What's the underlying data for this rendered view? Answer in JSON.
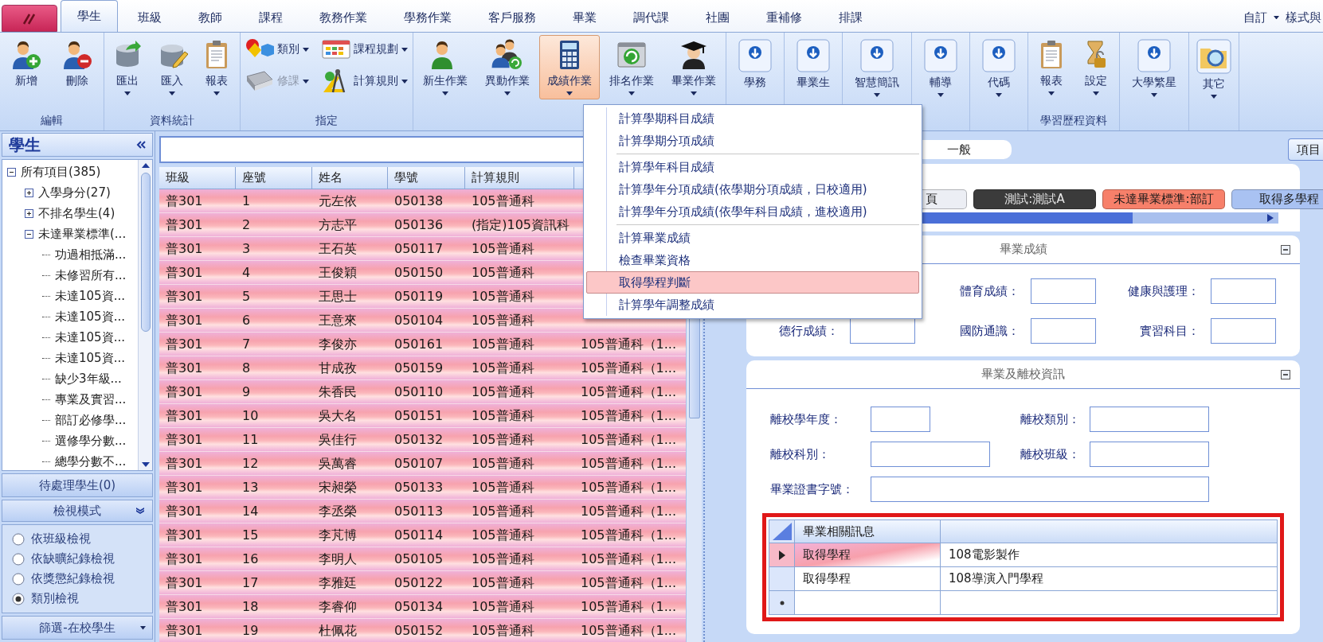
{
  "tabs": [
    {
      "label": "學生",
      "selected": true
    },
    {
      "label": "班級",
      "selected": false
    },
    {
      "label": "教師",
      "selected": false
    },
    {
      "label": "課程",
      "selected": false
    },
    {
      "label": "教務作業",
      "selected": false
    },
    {
      "label": "學務作業",
      "selected": false
    },
    {
      "label": "客戶服務",
      "selected": false
    },
    {
      "label": "畢業",
      "selected": false
    },
    {
      "label": "調代課",
      "selected": false
    },
    {
      "label": "社團",
      "selected": false
    },
    {
      "label": "重補修",
      "selected": false
    },
    {
      "label": "排課",
      "selected": false
    }
  ],
  "quick": {
    "customize": "自訂",
    "style": "樣式與"
  },
  "ribbon": [
    {
      "label": "編輯",
      "items": [
        {
          "kind": "large",
          "label": "新增",
          "dropdown": false,
          "pressed": false
        },
        {
          "kind": "large",
          "label": "刪除",
          "dropdown": false,
          "pressed": false
        }
      ]
    },
    {
      "label": "資料統計",
      "items": [
        {
          "kind": "large",
          "label": "匯出",
          "dropdown": true,
          "pressed": false
        },
        {
          "kind": "large",
          "label": "匯入",
          "dropdown": true,
          "pressed": false
        },
        {
          "kind": "large",
          "label": "報表",
          "dropdown": true,
          "pressed": false
        }
      ]
    },
    {
      "label": "指定",
      "items": [
        {
          "kind": "small",
          "label": "類別",
          "dropdown": true,
          "disabled": false
        },
        {
          "kind": "small",
          "label": "課程規劃",
          "dropdown": true,
          "disabled": false
        },
        {
          "kind": "small",
          "label": "修課",
          "dropdown": true,
          "disabled": true
        },
        {
          "kind": "small",
          "label": "計算規則",
          "dropdown": true,
          "disabled": false
        }
      ]
    },
    {
      "items": [
        {
          "kind": "large",
          "label": "新生作業",
          "dropdown": true,
          "pressed": false
        },
        {
          "kind": "large",
          "label": "異動作業",
          "dropdown": true,
          "pressed": false
        },
        {
          "kind": "large",
          "label": "成績作業",
          "dropdown": true,
          "pressed": true
        },
        {
          "kind": "large",
          "label": "排名作業",
          "dropdown": true,
          "pressed": false
        },
        {
          "kind": "large",
          "label": "畢業作業",
          "dropdown": true,
          "pressed": false
        }
      ]
    },
    {
      "items": [
        {
          "kind": "arrow",
          "label": "學務",
          "dropdown": false
        }
      ]
    },
    {
      "items": [
        {
          "kind": "arrow",
          "label": "畢業生",
          "dropdown": false
        }
      ]
    },
    {
      "items": [
        {
          "kind": "arrow",
          "label": "智慧簡訊",
          "dropdown": true
        }
      ]
    },
    {
      "items": [
        {
          "kind": "arrow",
          "label": "輔導",
          "dropdown": true
        }
      ]
    },
    {
      "items": [
        {
          "kind": "arrow",
          "label": "代碼",
          "dropdown": true
        }
      ]
    },
    {
      "label": "學習歷程資料",
      "items": [
        {
          "kind": "large",
          "label": "報表",
          "dropdown": true,
          "pressed": false
        },
        {
          "kind": "large",
          "label": "設定",
          "dropdown": true,
          "pressed": false
        }
      ]
    },
    {
      "items": [
        {
          "kind": "arrow",
          "label": "大學繁星",
          "dropdown": true
        }
      ]
    },
    {
      "items": [
        {
          "kind": "large",
          "label": "其它",
          "dropdown": true,
          "pressed": false
        }
      ]
    }
  ],
  "left_panel": {
    "title": "學生",
    "tree": [
      {
        "label": "所有項目(385)",
        "expanded": true,
        "children": [
          {
            "label": "入學身分(27)",
            "expanded": false
          },
          {
            "label": "不排名學生(4)",
            "expanded": false
          },
          {
            "label": "未達畢業標準(...",
            "expanded": true,
            "children": [
              {
                "label": "功過相抵滿..."
              },
              {
                "label": "未修習所有..."
              },
              {
                "label": "未達105資..."
              },
              {
                "label": "未達105資..."
              },
              {
                "label": "未達105資..."
              },
              {
                "label": "未達105資..."
              },
              {
                "label": "缺少3年級..."
              },
              {
                "label": "專業及實習..."
              },
              {
                "label": "部訂必修學..."
              },
              {
                "label": "選修學分數..."
              },
              {
                "label": "總學分數不..."
              }
            ]
          }
        ]
      }
    ],
    "pending": "待處理學生(0)",
    "view_mode": {
      "title": "檢視模式",
      "options": [
        {
          "label": "依班級檢視",
          "selected": false
        },
        {
          "label": "依缺曠紀錄檢視",
          "selected": false
        },
        {
          "label": "依獎懲紀錄檢視",
          "selected": false
        },
        {
          "label": "類別檢視",
          "selected": true
        }
      ]
    },
    "filter": "篩選-在校學生"
  },
  "table": {
    "columns": [
      "班級",
      "座號",
      "姓名",
      "學號",
      "計算規則"
    ],
    "rows": [
      {
        "selected": true,
        "cells": [
          "普301",
          "1",
          "元左依",
          "050138",
          "105普通科"
        ]
      },
      {
        "selected": true,
        "cells": [
          "普301",
          "2",
          "方志平",
          "050136",
          "(指定)105資訊科"
        ]
      },
      {
        "selected": true,
        "cells": [
          "普301",
          "3",
          "王石英",
          "050117",
          "105普通科"
        ]
      },
      {
        "selected": true,
        "cells": [
          "普301",
          "4",
          "王俊穎",
          "050150",
          "105普通科"
        ]
      },
      {
        "selected": true,
        "cells": [
          "普301",
          "5",
          "王思士",
          "050119",
          "105普通科"
        ]
      },
      {
        "selected": true,
        "cells": [
          "普301",
          "6",
          "王意來",
          "050104",
          "105普通科"
        ]
      },
      {
        "selected": true,
        "cells": [
          "普301",
          "7",
          "李俊亦",
          "050161",
          "105普通科",
          "105普通科（1..."
        ]
      },
      {
        "selected": true,
        "cells": [
          "普301",
          "8",
          "甘成孜",
          "050159",
          "105普通科",
          "105普通科（1..."
        ]
      },
      {
        "selected": true,
        "cells": [
          "普301",
          "9",
          "朱香民",
          "050110",
          "105普通科",
          "105普通科（1..."
        ]
      },
      {
        "selected": true,
        "cells": [
          "普301",
          "10",
          "吳大名",
          "050151",
          "105普通科",
          "105普通科（1..."
        ]
      },
      {
        "selected": true,
        "cells": [
          "普301",
          "11",
          "吳佳行",
          "050132",
          "105普通科",
          "105普通科（1..."
        ]
      },
      {
        "selected": true,
        "cells": [
          "普301",
          "12",
          "吳萬睿",
          "050107",
          "105普通科",
          "105普通科（1..."
        ]
      },
      {
        "selected": true,
        "cells": [
          "普301",
          "13",
          "宋昶榮",
          "050133",
          "105普通科",
          "105普通科（1..."
        ]
      },
      {
        "selected": true,
        "cells": [
          "普301",
          "14",
          "李丞榮",
          "050113",
          "105普通科",
          "105普通科（1..."
        ]
      },
      {
        "selected": true,
        "cells": [
          "普301",
          "15",
          "李芃博",
          "050114",
          "105普通科",
          "105普通科（1..."
        ]
      },
      {
        "selected": true,
        "cells": [
          "普301",
          "16",
          "李明人",
          "050105",
          "105普通科",
          "105普通科（1..."
        ]
      },
      {
        "selected": true,
        "cells": [
          "普301",
          "17",
          "李雅廷",
          "050122",
          "105普通科",
          "105普通科（1..."
        ]
      },
      {
        "selected": true,
        "cells": [
          "普301",
          "18",
          "李睿仰",
          "050134",
          "105普通科",
          "105普通科（1..."
        ]
      },
      {
        "selected": true,
        "cells": [
          "普301",
          "19",
          "杜佩花",
          "050152",
          "105普通科",
          "105普通科（1..."
        ]
      }
    ]
  },
  "right_panel": {
    "tab": "一般",
    "side_button": "項目",
    "tags": [
      {
        "label": "頁",
        "color": "#eceef4"
      },
      {
        "label": "測試:測試A",
        "color": "#3b3b3b"
      },
      {
        "label": "未達畢業標準:部訂",
        "color": "#f7806a"
      },
      {
        "label": "取得多學程",
        "color": "#a9c2f2"
      }
    ],
    "grades": {
      "title": "畢業成績",
      "fields": [
        {
          "label": "體育成績："
        },
        {
          "label": "健康與護理："
        },
        {
          "label": "德行成績："
        },
        {
          "label": "國防通識："
        },
        {
          "label": "實習科目："
        }
      ]
    },
    "leaving": {
      "title": "畢業及離校資訊",
      "rows": [
        [
          {
            "label": "離校學年度："
          },
          {
            "label": "離校類別："
          }
        ],
        [
          {
            "label": "離校科別："
          },
          {
            "label": "離校班級："
          }
        ],
        [
          {
            "label": "畢業證書字號："
          }
        ]
      ]
    },
    "grid": {
      "highlighted": true,
      "columns": [
        "畢業相關訊息"
      ],
      "rows": [
        {
          "current": true,
          "cells": [
            "取得學程",
            "108電影製作"
          ]
        },
        {
          "current": false,
          "cells": [
            "取得學程",
            "108導演入門學程"
          ]
        }
      ]
    }
  },
  "menu": {
    "groups": [
      [
        {
          "label": "計算學期科目成績",
          "selected": false
        },
        {
          "label": "計算學期分項成績",
          "selected": false
        }
      ],
      [
        {
          "label": "計算學年科目成績",
          "selected": false
        },
        {
          "label": "計算學年分項成績(依學期分項成績，日校適用)",
          "selected": false
        },
        {
          "label": "計算學年分項成績(依學年科目成績，進校適用)",
          "selected": false
        }
      ],
      [
        {
          "label": "計算畢業成績",
          "selected": false
        },
        {
          "label": "檢查畢業資格",
          "selected": false
        },
        {
          "label": "取得學程判斷",
          "selected": true
        },
        {
          "label": "計算學年調整成績",
          "selected": false
        }
      ]
    ]
  }
}
